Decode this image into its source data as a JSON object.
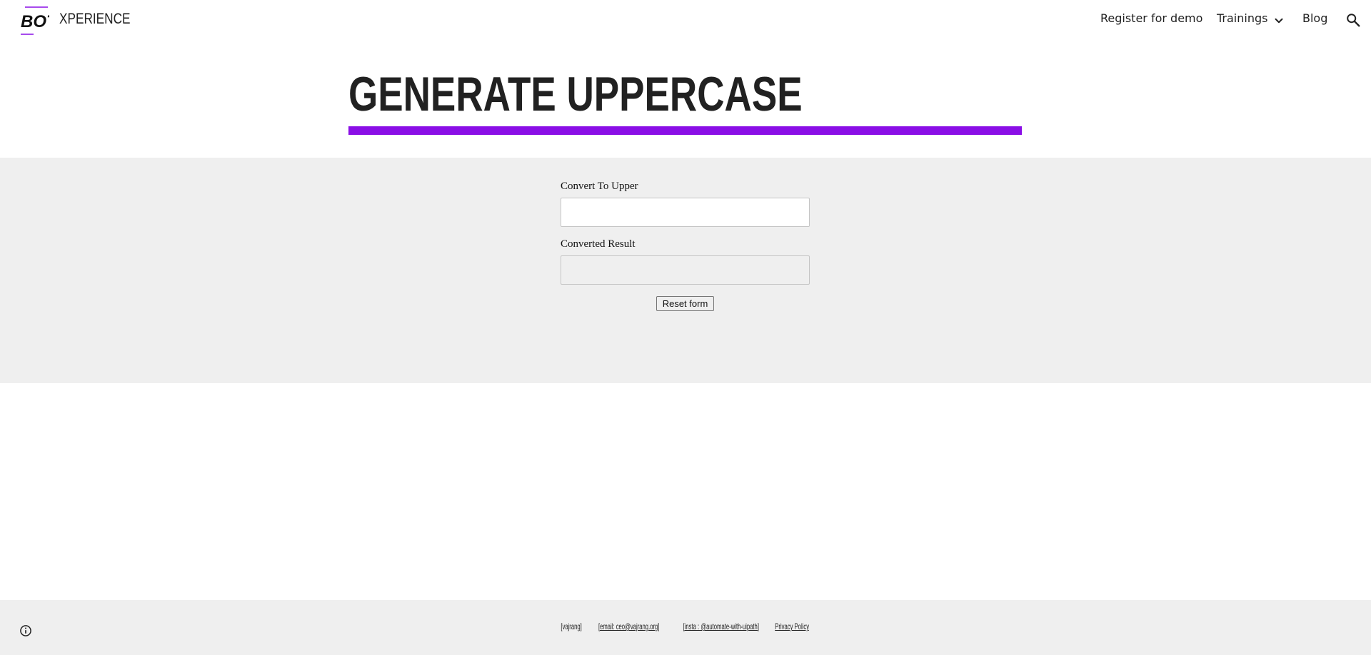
{
  "header": {
    "logo_icon": "botxperience-logo-icon",
    "site_name": "XPERIENCE",
    "nav": {
      "register": "Register for demo",
      "trainings": "Trainings",
      "blog": "Blog"
    },
    "icons": {
      "dropdown": "chevron-down-icon",
      "search": "search-icon"
    }
  },
  "page": {
    "title": "GENERATE UPPERCASE",
    "accent_color": "#8a0ee6"
  },
  "form": {
    "input_label": "Convert To Upper",
    "input_value": "",
    "result_label": "Converted Result",
    "result_value": "",
    "reset_label": "Reset form"
  },
  "footer": {
    "name": "[vajrang]",
    "email": "[email: ceo@vajrang.org]",
    "insta": "[insta : @automate-with-uipath]",
    "privacy": "Privacy Policy",
    "info_icon": "info-icon"
  }
}
